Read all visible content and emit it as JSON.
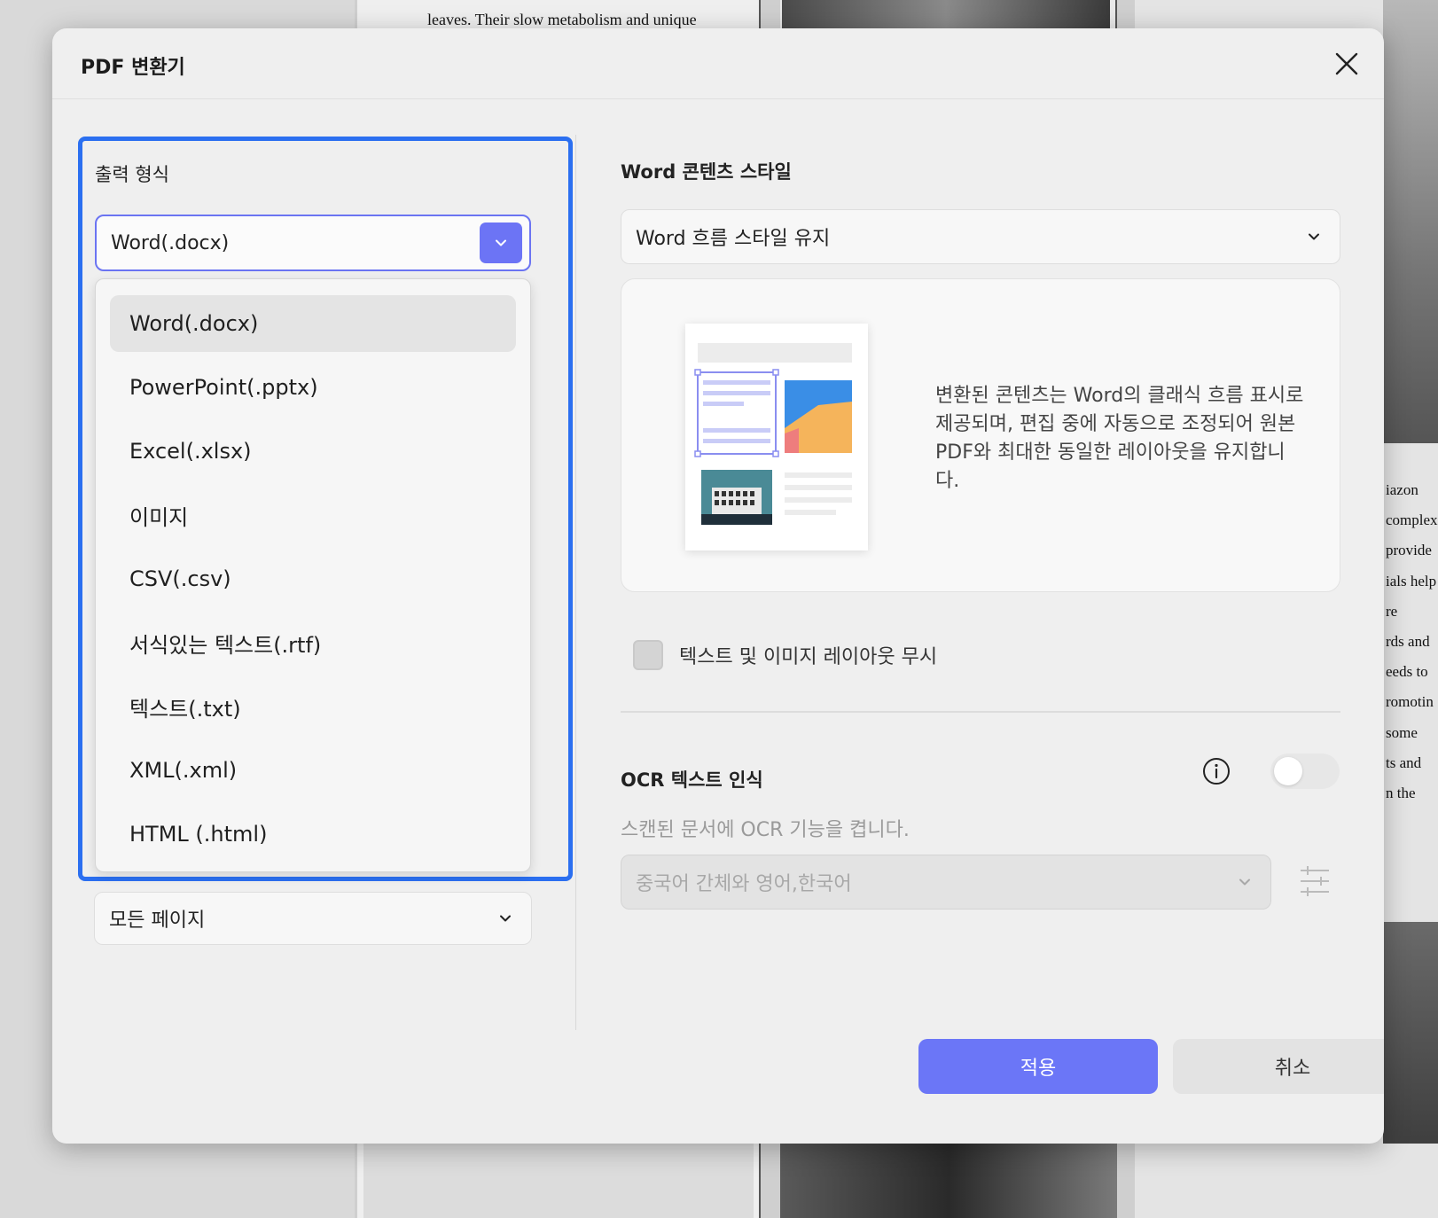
{
  "background": {
    "top_text": "leaves. Their slow metabolism and unique",
    "side_lines": [
      "iazon",
      "complex",
      "provide",
      "ials help",
      "re",
      "rds and",
      "eeds to",
      "romotin",
      "some",
      "ts and",
      "n the"
    ]
  },
  "dialog": {
    "title": "PDF 변환기",
    "close_icon": "close-icon"
  },
  "output_format": {
    "label": "출력 형식",
    "selected": "Word(.docx)",
    "options": [
      "Word(.docx)",
      "PowerPoint(.pptx)",
      "Excel(.xlsx)",
      "이미지",
      "CSV(.csv)",
      "서식있는 텍스트(.rtf)",
      "텍스트(.txt)",
      "XML(.xml)",
      "HTML (.html)"
    ]
  },
  "page_range": {
    "selected": "모든 페이지"
  },
  "word_style": {
    "label": "Word 콘텐츠 스타일",
    "selected": "Word 흐름 스타일 유지",
    "description": "변환된 콘텐츠는 Word의 클래식 흐름 표시로 제공되며, 편집 중에 자동으로 조정되어 원본 PDF와 최대한 동일한 레이아웃을 유지합니다."
  },
  "ignore_layout": {
    "label": "텍스트 및 이미지 레이아웃 무시",
    "checked": false
  },
  "ocr": {
    "label": "OCR 텍스트 인식",
    "description": "스캔된 문서에 OCR 기능을 켭니다.",
    "enabled": false,
    "language": "중국어 간체와 영어,한국어"
  },
  "buttons": {
    "apply": "적용",
    "cancel": "취소"
  },
  "colors": {
    "accent": "#6b76f7",
    "focus_border": "#2b6ff0"
  }
}
